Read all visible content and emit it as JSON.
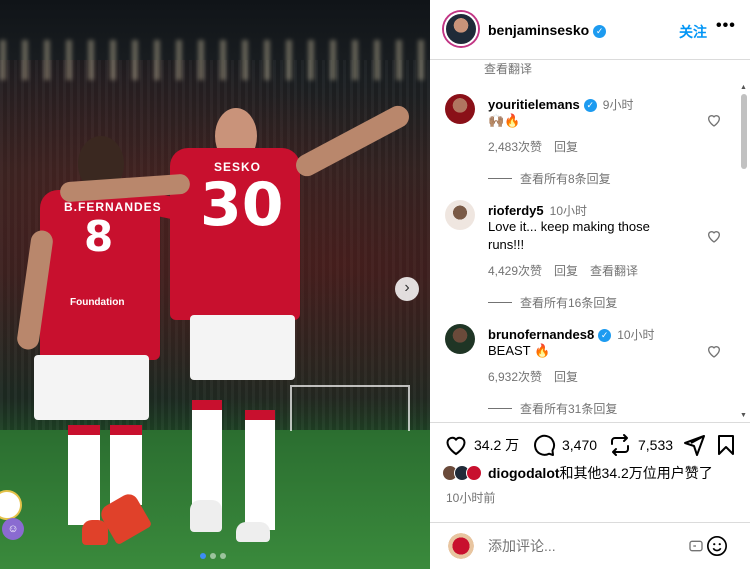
{
  "photo": {
    "player_left": {
      "shirt_name": "B.FERNANDES",
      "shirt_number": "8",
      "sponsor": "Foundation"
    },
    "player_right": {
      "shirt_name": "SESKO",
      "shirt_number": "30"
    },
    "next_icon": "chevron-right-icon",
    "carousel": {
      "count": 3,
      "active": 0
    }
  },
  "header": {
    "username": "benjaminsesko",
    "verified": true,
    "follow_label": "关注",
    "more_label": "•••"
  },
  "comments": {
    "top_translate": "查看翻译",
    "items": [
      {
        "username": "youritielemans",
        "verified": true,
        "time": "9小时",
        "text": "🙌🏽🔥",
        "likes": "2,483次赞",
        "reply": "回复",
        "translate": "",
        "view_replies": "查看所有8条回复"
      },
      {
        "username": "rioferdy5",
        "verified": false,
        "time": "10小时",
        "text": "Love it... keep making those runs!!!",
        "likes": "4,429次赞",
        "reply": "回复",
        "translate": "查看翻译",
        "view_replies": "查看所有16条回复"
      },
      {
        "username": "brunofernandes8",
        "verified": true,
        "time": "10小时",
        "text": "BEAST 🔥",
        "likes": "6,932次赞",
        "reply": "回复",
        "translate": "",
        "view_replies": "查看所有31条回复"
      }
    ]
  },
  "actions": {
    "like_count": "34.2 万",
    "comment_count": "3,470",
    "repost_count": "7,533",
    "liked_by_user": "diogodalot",
    "liked_by_rest": "和其他34.2万位用户赞了",
    "post_time": "10小时前"
  },
  "add_comment": {
    "placeholder": "添加评论..."
  },
  "colors": {
    "accent": "#0095f6",
    "verified": "#1d9bf0",
    "muted": "#737373",
    "kit_red": "#c8102e"
  }
}
